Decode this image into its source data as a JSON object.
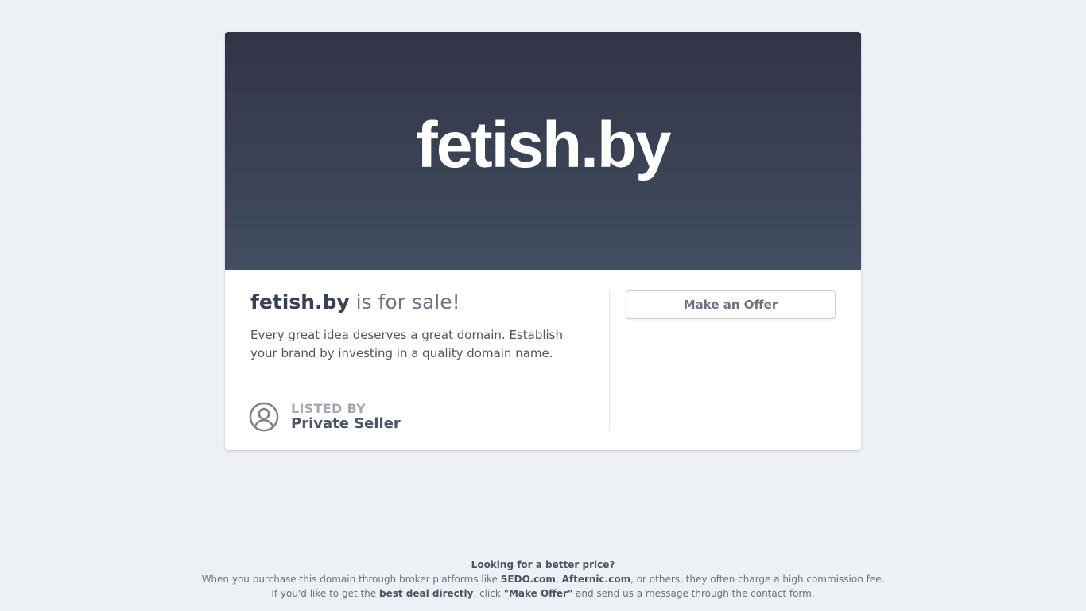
{
  "hero": {
    "domain": "fetish.by"
  },
  "sale": {
    "domain": "fetish.by",
    "suffix": " is for sale!",
    "description": "Every great idea deserves a great domain. Establish your brand by investing in a quality domain name."
  },
  "seller": {
    "listed_by_label": "LISTED BY",
    "name": "Private Seller",
    "icon": "user-circle-icon"
  },
  "offer": {
    "button_label": "Make an Offer"
  },
  "footer": {
    "heading": "Looking for a better price?",
    "line1_pre": "When you purchase this domain through broker platforms like ",
    "sedo": "SEDO.com",
    "comma": ", ",
    "afternic": "Afternic.com",
    "line1_post": ", or others, they often charge a high commission fee.",
    "line2_pre": "If you'd like to get the ",
    "best_deal": "best deal directly",
    "line2_mid": ", click ",
    "make_offer": "\"Make Offer\"",
    "line2_post": " and send us a message through the contact form."
  },
  "colors": {
    "background": "#edf0f5",
    "hero_top": "#323446",
    "hero_bottom": "#424e61",
    "card": "#ffffff"
  }
}
